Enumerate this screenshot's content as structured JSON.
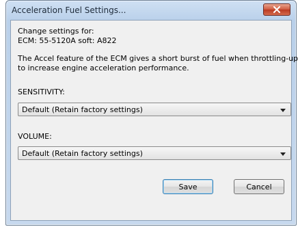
{
  "window": {
    "title": "Acceleration Fuel Settings..."
  },
  "body": {
    "change_settings_for": "Change settings for:",
    "ecm_info": "ECM: 55-5120A soft: A822",
    "description_line1": "The Accel feature of the ECM gives a short burst of fuel when throttling-up",
    "description_line2": "to increase engine acceleration performance."
  },
  "sensitivity": {
    "label": "SENSITIVITY:",
    "selected": "Default (Retain factory settings)"
  },
  "volume": {
    "label": "VOLUME:",
    "selected": "Default (Retain factory settings)"
  },
  "buttons": {
    "save": "Save",
    "cancel": "Cancel"
  },
  "icons": {
    "close": "close-icon",
    "dropdown": "chevron-down-icon"
  },
  "colors": {
    "close_button": "#cf5a3f",
    "title_bar": "#b9d0ea",
    "client_bg": "#f0f0f0"
  }
}
